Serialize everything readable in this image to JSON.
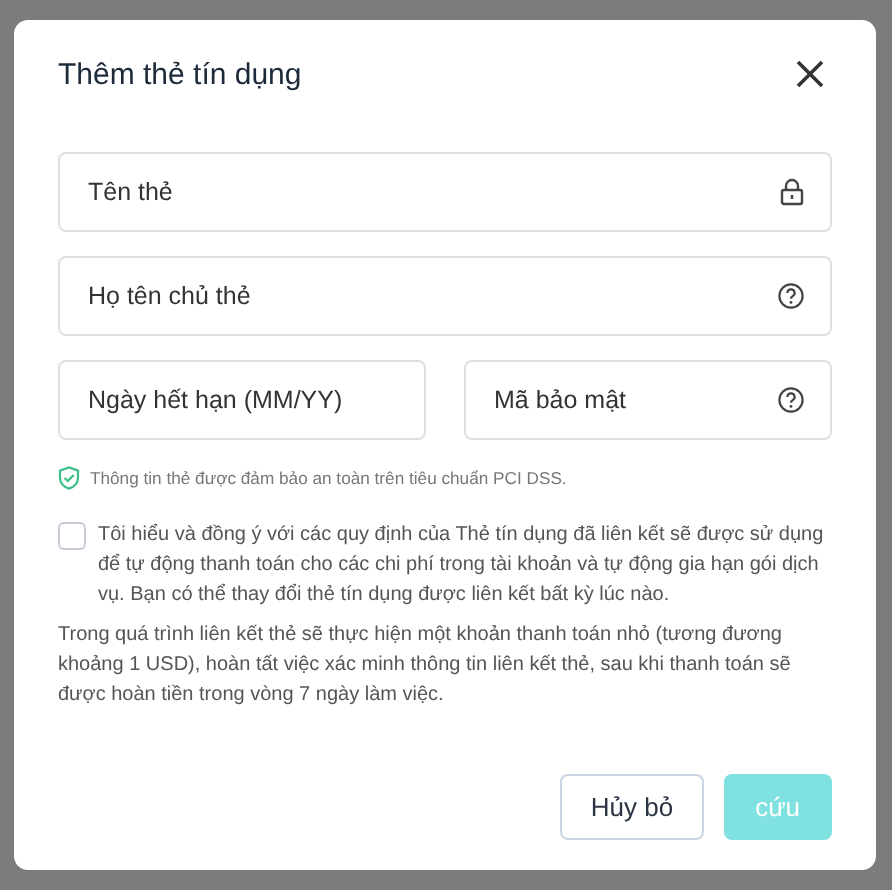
{
  "dialog": {
    "title": "Thêm thẻ tín dụng"
  },
  "fields": [
    {
      "placeholder": "Tên thẻ",
      "kind": "locked"
    },
    {
      "placeholder": "Họ tên chủ thẻ",
      "kind": "help"
    }
  ],
  "field_row": [
    {
      "placeholder": "Ngày hết hạn (MM/YY)",
      "kind": "plain"
    },
    {
      "placeholder": "Mã bảo mật",
      "kind": "help"
    }
  ],
  "security_note": "Thông tin thẻ được đảm bảo an toàn trên tiêu chuẩn PCI DSS.",
  "agreement": {
    "checked": false,
    "text": "Tôi hiểu và đồng ý với các quy định của  Thẻ tín dụng đã liên kết sẽ được sử dụng để tự động thanh toán cho các chi phí trong tài khoản và tự động gia hạn gói dịch vụ. Bạn có thể thay đổi thẻ tín dụng được liên kết bất kỳ lúc nào."
  },
  "info": "Trong quá trình liên kết thẻ sẽ thực hiện một khoản thanh toán nhỏ (tương đương khoảng 1 USD), hoàn tất việc xác minh thông tin liên kết thẻ, sau khi thanh toán sẽ được hoàn tiền trong vòng 7 ngày làm việc.",
  "buttons": [
    {
      "label": "Hủy bỏ",
      "kind": "secondary",
      "disabled": false
    },
    {
      "label": "cứu",
      "kind": "primary",
      "disabled": true
    }
  ]
}
